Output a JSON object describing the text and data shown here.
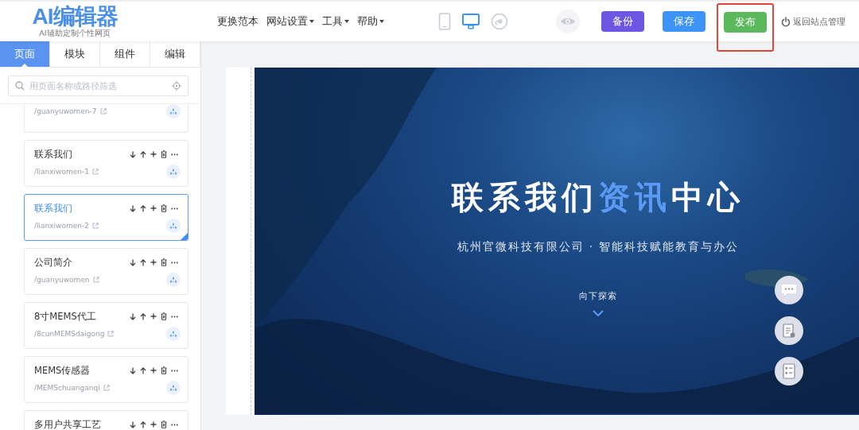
{
  "header": {
    "logo": {
      "title": "AI编辑器",
      "tagline": "AI辅助定制个性网页"
    },
    "nav": [
      {
        "label": "更换范本",
        "dropdown": false
      },
      {
        "label": "网站设置",
        "dropdown": true
      },
      {
        "label": "工具",
        "dropdown": true
      },
      {
        "label": "帮助",
        "dropdown": true
      }
    ],
    "devices": [
      {
        "kind": "phone",
        "selected": false
      },
      {
        "kind": "desktop",
        "selected": true
      },
      {
        "kind": "mini-program",
        "selected": false
      }
    ],
    "actions": [
      {
        "label": "备份",
        "color": "#6e56e4",
        "highlighted": false
      },
      {
        "label": "保存",
        "color": "#3e93f7",
        "highlighted": false
      },
      {
        "label": "发布",
        "color": "#5cb85c",
        "highlighted": true
      }
    ],
    "back_link": "返回站点管理"
  },
  "sidebar": {
    "tabs": [
      {
        "label": "页面",
        "selected": true
      },
      {
        "label": "模块",
        "selected": false
      },
      {
        "label": "组件",
        "selected": false
      },
      {
        "label": "编辑",
        "selected": false
      }
    ],
    "search": {
      "placeholder": "用页面名称或路径筛选"
    },
    "pages": [
      {
        "path": "/guanyuwomen-7",
        "selected": false
      },
      {
        "name": "联系我们",
        "path": "/lianxiwomen-1",
        "selected": false
      },
      {
        "name": "联系我们",
        "path": "/lianxiwomen-2",
        "selected": true
      },
      {
        "name": "公司简介",
        "path": "/guanyuwomen",
        "selected": false
      },
      {
        "name": "8寸MEMS代工",
        "path": "/8cunMEMSdaigong",
        "selected": false
      },
      {
        "name": "MEMS传感器",
        "path": "/MEMSchuanganqi",
        "selected": false
      },
      {
        "name": "多用户共享工艺",
        "selected": false
      }
    ]
  },
  "preview": {
    "title": [
      {
        "text": "联系我们",
        "accent": false
      },
      {
        "text": "资讯",
        "accent": true
      },
      {
        "text": "中心",
        "accent": false
      }
    ],
    "subtitle": "杭州官微科技有限公司 · 智能科技赋能教育与办公",
    "scroll_hint": "向下探索"
  }
}
